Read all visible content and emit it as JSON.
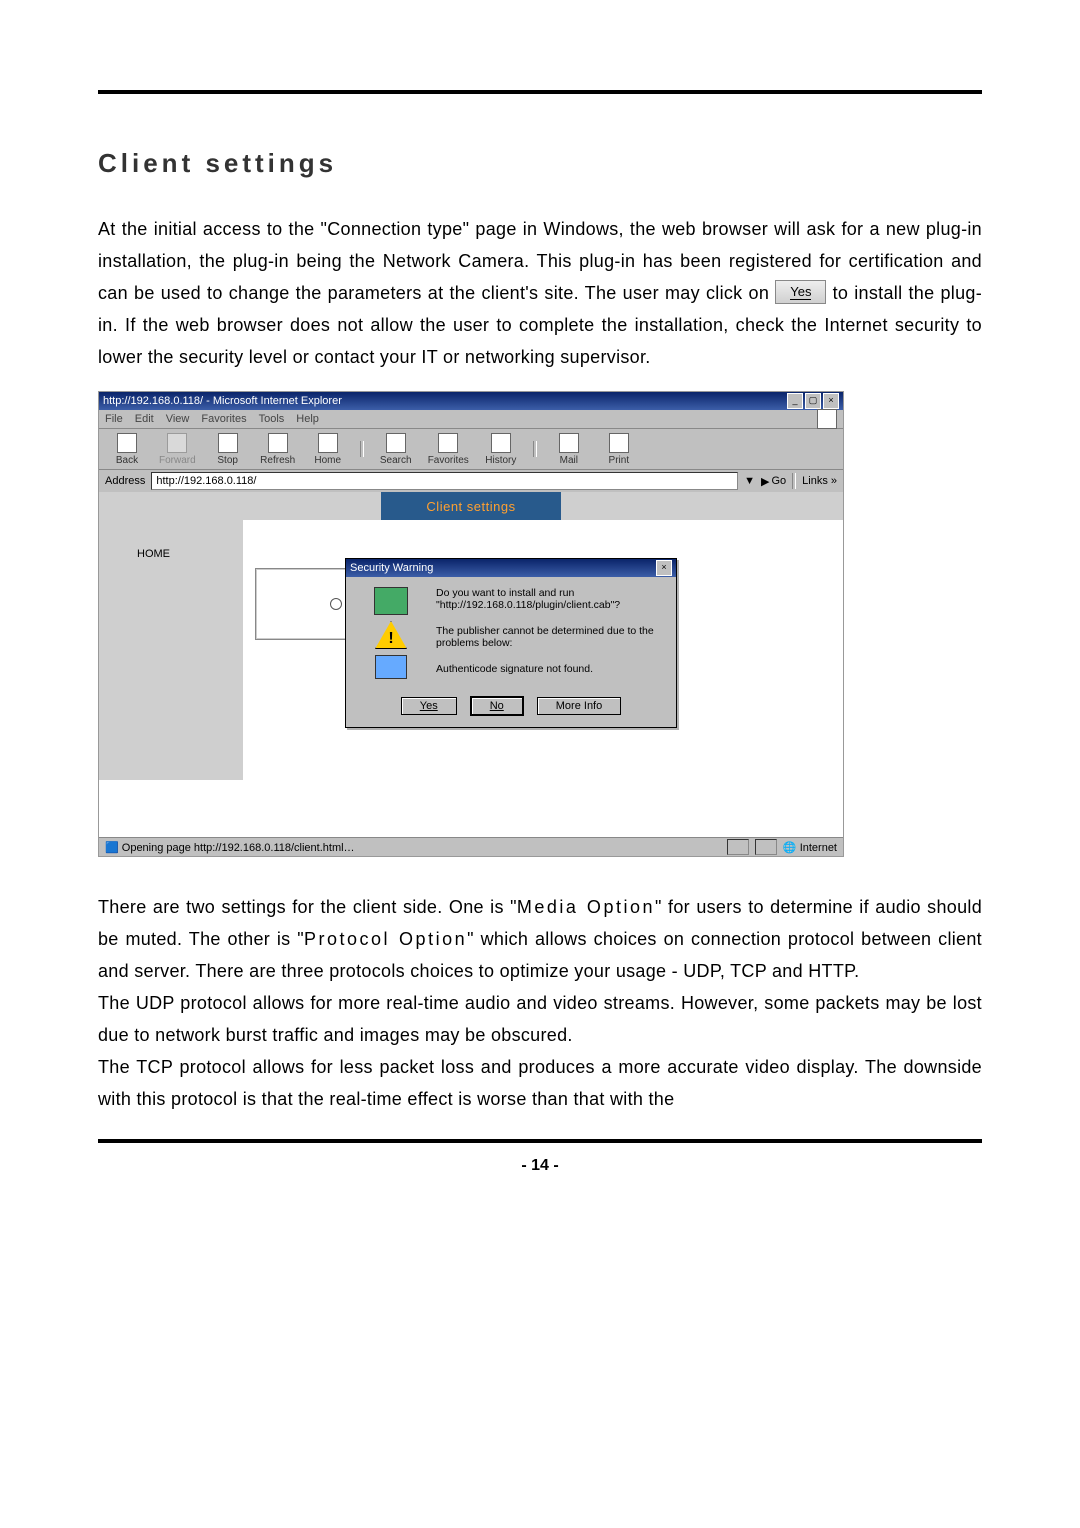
{
  "heading": "Client settings",
  "para1_a": "At the initial access to the \"Connection type\" page in Windows, the web browser will ask for a new plug-in installation, the plug-in being the Network Camera. This plug-in has been registered for certification and can be used to change the parameters at the client's site.   The user may click on ",
  "yes_chip": "Yes",
  "para1_b": " to install the plug-in. If the web browser does not allow the user to complete the installation, check the Internet security to lower the security level or contact your IT or networking supervisor.",
  "ie": {
    "title": "http://192.168.0.118/ - Microsoft Internet Explorer",
    "menus": [
      "File",
      "Edit",
      "View",
      "Favorites",
      "Tools",
      "Help"
    ],
    "toolbar": [
      {
        "label": "Back"
      },
      {
        "label": "Forward"
      },
      {
        "label": "Stop"
      },
      {
        "label": "Refresh"
      },
      {
        "label": "Home"
      },
      {
        "label": "Search"
      },
      {
        "label": "Favorites"
      },
      {
        "label": "History"
      },
      {
        "label": "Mail"
      },
      {
        "label": "Print"
      }
    ],
    "address_label": "Address",
    "address_value": "http://192.168.0.118/",
    "go_label": "Go",
    "links_label": "Links »",
    "content_header": "Client settings",
    "home_link": "HOME",
    "status_text": "Opening page http://192.168.0.118/client.html…",
    "zone_text": "Internet"
  },
  "dialog": {
    "title": "Security Warning",
    "line1": "Do you want to install and run \"http://192.168.0.118/plugin/client.cab\"?",
    "line2": "The publisher cannot be determined due to the problems below:",
    "line3": "Authenticode signature not found.",
    "btn_yes": "Yes",
    "btn_no": "No",
    "btn_more": "More Info"
  },
  "para2_a": "There are two settings for the client side. One is \"",
  "media": "Media Option",
  "para2_b": "\" for users to determine if audio should be muted. The other is \"",
  "proto": "Protocol Option",
  "para2_c": "\" which allows choices on connection protocol between client and server. There are three protocols choices to optimize your usage -  UDP, TCP and HTTP.",
  "para3": "The UDP protocol allows for more real-time audio and video streams. However, some packets may be lost due to network burst traffic and images may be obscured.",
  "para4": "The TCP protocol allows for less packet loss and produces a more accurate video display. The downside with this protocol is that the real-time effect is worse than that with the",
  "page_number": "- 14 -"
}
